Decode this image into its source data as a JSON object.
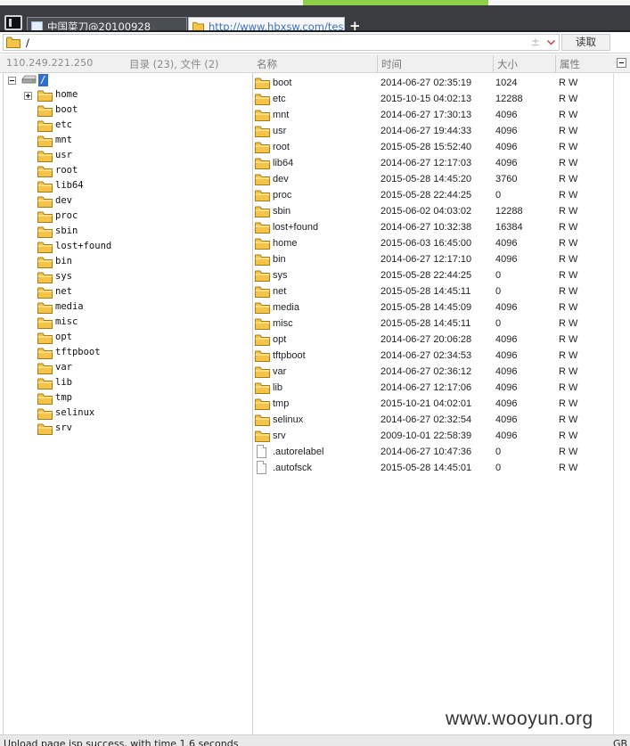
{
  "tabs": [
    {
      "label": "中国菜刀@20100928",
      "icon": "window-icon"
    },
    {
      "label": "http://www.hbxsw.com/test.jsp",
      "icon": "folder-icon"
    }
  ],
  "add_tab_label": "+",
  "pathbar": {
    "value": "/",
    "read_label": "读取",
    "toggle_label": "±"
  },
  "info": {
    "ip": "110.249.221.250",
    "counts": "目录 (23), 文件 (2)"
  },
  "columns": {
    "name": "名称",
    "time": "时间",
    "size": "大小",
    "attr": "属性"
  },
  "tree": {
    "root": "/",
    "items": [
      "home",
      "boot",
      "etc",
      "mnt",
      "usr",
      "root",
      "lib64",
      "dev",
      "proc",
      "sbin",
      "lost+found",
      "bin",
      "sys",
      "net",
      "media",
      "misc",
      "opt",
      "tftpboot",
      "var",
      "lib",
      "tmp",
      "selinux",
      "srv"
    ]
  },
  "files": [
    {
      "name": "boot",
      "time": "2014-06-27 02:35:19",
      "size": "1024",
      "attr": "R W",
      "type": "dir"
    },
    {
      "name": "etc",
      "time": "2015-10-15 04:02:13",
      "size": "12288",
      "attr": "R W",
      "type": "dir"
    },
    {
      "name": "mnt",
      "time": "2014-06-27 17:30:13",
      "size": "4096",
      "attr": "R W",
      "type": "dir"
    },
    {
      "name": "usr",
      "time": "2014-06-27 19:44:33",
      "size": "4096",
      "attr": "R W",
      "type": "dir"
    },
    {
      "name": "root",
      "time": "2015-05-28 15:52:40",
      "size": "4096",
      "attr": "R W",
      "type": "dir"
    },
    {
      "name": "lib64",
      "time": "2014-06-27 12:17:03",
      "size": "4096",
      "attr": "R W",
      "type": "dir"
    },
    {
      "name": "dev",
      "time": "2015-05-28 14:45:20",
      "size": "3760",
      "attr": "R W",
      "type": "dir"
    },
    {
      "name": "proc",
      "time": "2015-05-28 22:44:25",
      "size": "0",
      "attr": "R W",
      "type": "dir"
    },
    {
      "name": "sbin",
      "time": "2015-06-02 04:03:02",
      "size": "12288",
      "attr": "R W",
      "type": "dir"
    },
    {
      "name": "lost+found",
      "time": "2014-06-27 10:32:38",
      "size": "16384",
      "attr": "R W",
      "type": "dir"
    },
    {
      "name": "home",
      "time": "2015-06-03 16:45:00",
      "size": "4096",
      "attr": "R W",
      "type": "dir"
    },
    {
      "name": "bin",
      "time": "2014-06-27 12:17:10",
      "size": "4096",
      "attr": "R W",
      "type": "dir"
    },
    {
      "name": "sys",
      "time": "2015-05-28 22:44:25",
      "size": "0",
      "attr": "R W",
      "type": "dir"
    },
    {
      "name": "net",
      "time": "2015-05-28 14:45:11",
      "size": "0",
      "attr": "R W",
      "type": "dir"
    },
    {
      "name": "media",
      "time": "2015-05-28 14:45:09",
      "size": "4096",
      "attr": "R W",
      "type": "dir"
    },
    {
      "name": "misc",
      "time": "2015-05-28 14:45:11",
      "size": "0",
      "attr": "R W",
      "type": "dir"
    },
    {
      "name": "opt",
      "time": "2014-06-27 20:06:28",
      "size": "4096",
      "attr": "R W",
      "type": "dir"
    },
    {
      "name": "tftpboot",
      "time": "2014-06-27 02:34:53",
      "size": "4096",
      "attr": "R W",
      "type": "dir"
    },
    {
      "name": "var",
      "time": "2014-06-27 02:36:12",
      "size": "4096",
      "attr": "R W",
      "type": "dir"
    },
    {
      "name": "lib",
      "time": "2014-06-27 12:17:06",
      "size": "4096",
      "attr": "R W",
      "type": "dir"
    },
    {
      "name": "tmp",
      "time": "2015-10-21 04:02:01",
      "size": "4096",
      "attr": "R W",
      "type": "dir"
    },
    {
      "name": "selinux",
      "time": "2014-06-27 02:32:54",
      "size": "4096",
      "attr": "R W",
      "type": "dir"
    },
    {
      "name": "srv",
      "time": "2009-10-01 22:58:39",
      "size": "4096",
      "attr": "R W",
      "type": "dir"
    },
    {
      "name": ".autorelabel",
      "time": "2014-06-27 10:47:36",
      "size": "0",
      "attr": "R W",
      "type": "file"
    },
    {
      "name": ".autofsck",
      "time": "2015-05-28 14:45:01",
      "size": "0",
      "attr": "R W",
      "type": "file"
    }
  ],
  "watermark": "www.wooyun.org",
  "status": {
    "text": "Upload page jsp success, with time 1.6 seconds",
    "right": "GB"
  },
  "colors": {
    "selection": "#2e6fd0",
    "folder": "#f3c447",
    "tab_link": "#3a73c8",
    "tabbar": "#3a3c3f",
    "top_accent": "#8fd04a"
  }
}
